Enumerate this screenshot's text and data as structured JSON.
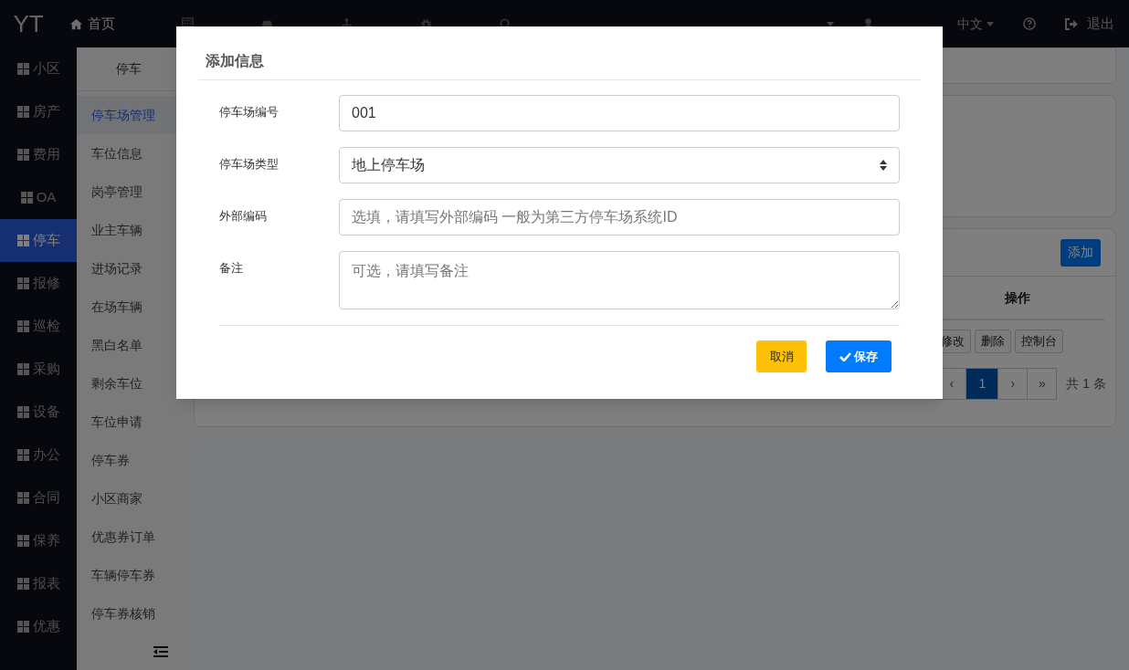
{
  "topbar": {
    "logo": "YT",
    "menu": [
      "首页"
    ],
    "language": "中文",
    "logout": "退出"
  },
  "sidebar": {
    "items": [
      {
        "label": "小区",
        "selected": false
      },
      {
        "label": "房产",
        "selected": false
      },
      {
        "label": "费用",
        "selected": false
      },
      {
        "label": "OA",
        "selected": false
      },
      {
        "label": "停车",
        "selected": true
      },
      {
        "label": "报修",
        "selected": false
      },
      {
        "label": "巡检",
        "selected": false
      },
      {
        "label": "采购",
        "selected": false
      },
      {
        "label": "设备",
        "selected": false
      },
      {
        "label": "办公",
        "selected": false
      },
      {
        "label": "合同",
        "selected": false
      },
      {
        "label": "保养",
        "selected": false
      },
      {
        "label": "报表",
        "selected": false
      },
      {
        "label": "优惠",
        "selected": false
      }
    ]
  },
  "submenu": {
    "title": "停车",
    "items": [
      {
        "label": "停车场管理",
        "selected": true
      },
      {
        "label": "车位信息",
        "selected": false
      },
      {
        "label": "岗亭管理",
        "selected": false
      },
      {
        "label": "业主车辆",
        "selected": false
      },
      {
        "label": "进场记录",
        "selected": false
      },
      {
        "label": "在场车辆",
        "selected": false
      },
      {
        "label": "黑白名单",
        "selected": false
      },
      {
        "label": "剩余车位",
        "selected": false
      },
      {
        "label": "车位申请",
        "selected": false
      },
      {
        "label": "停车券",
        "selected": false
      },
      {
        "label": "小区商家",
        "selected": false
      },
      {
        "label": "优惠券订单",
        "selected": false
      },
      {
        "label": "车辆停车券",
        "selected": false
      },
      {
        "label": "停车券核销",
        "selected": false
      }
    ]
  },
  "list": {
    "add_button": "添加",
    "column_header": "操作",
    "row_actions": [
      "修改",
      "删除",
      "控制台"
    ],
    "pagination": [
      {
        "label": "‹",
        "selected": false
      },
      {
        "label": "1",
        "selected": true
      },
      {
        "label": "›",
        "selected": false
      },
      {
        "label": "»",
        "selected": false
      }
    ],
    "total": "共 1 条"
  },
  "dialog": {
    "title": "添加信息",
    "fields": [
      {
        "kind": "input",
        "label": "停车场编号",
        "value": "001"
      },
      {
        "kind": "select",
        "label": "停车场类型",
        "value": "地上停车场"
      },
      {
        "kind": "input",
        "label": "外部编码",
        "placeholder": "选填，请填写外部编码 一般为第三方停车场系统ID"
      },
      {
        "kind": "textarea",
        "label": "备注",
        "placeholder": "可选，请填写备注"
      }
    ],
    "cancel": "取消",
    "save": "保存"
  }
}
